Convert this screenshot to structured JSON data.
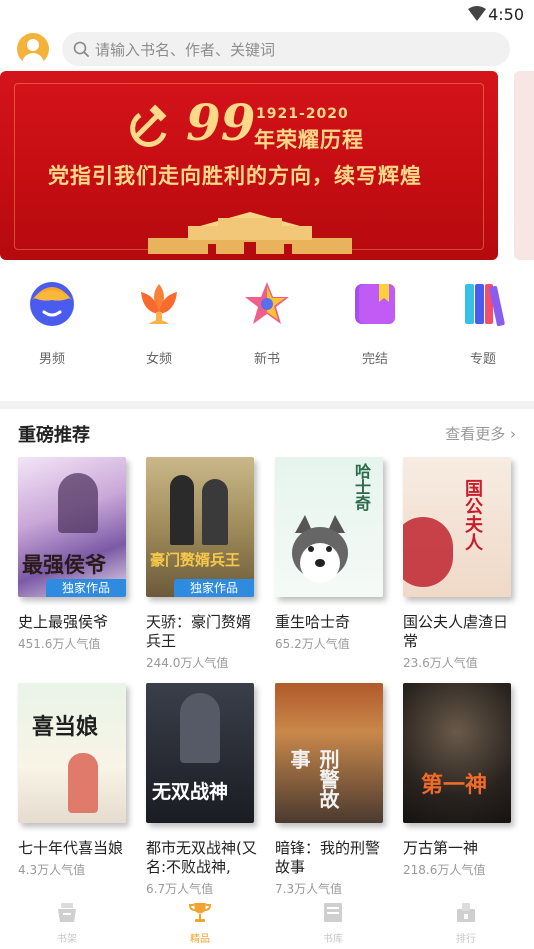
{
  "status": {
    "time": "4:50"
  },
  "search": {
    "placeholder": "请输入书名、作者、关键词"
  },
  "banner": {
    "number": "99",
    "years": "1921-2020",
    "honor": "年荣耀历程",
    "slogan": "党指引我们走向胜利的方向，续写辉煌"
  },
  "categories": [
    {
      "label": "男频",
      "icon": "male-channel-icon"
    },
    {
      "label": "女频",
      "icon": "female-channel-icon"
    },
    {
      "label": "新书",
      "icon": "new-book-star-icon"
    },
    {
      "label": "完结",
      "icon": "completed-book-icon"
    },
    {
      "label": "专题",
      "icon": "topic-books-icon"
    }
  ],
  "section": {
    "title": "重磅推荐",
    "more": "查看更多 ›"
  },
  "books": [
    {
      "title": "史上最强侯爷",
      "popularity": "451.6万人气值",
      "badge": "独家作品",
      "cover_text": "最强侯爷"
    },
    {
      "title": "天骄：豪门赘婿兵王",
      "popularity": "244.0万人气值",
      "badge": "独家作品",
      "cover_text": "豪门赘婿兵王"
    },
    {
      "title": "重生哈士奇",
      "popularity": "65.2万人气值",
      "badge": "",
      "cover_text": "哈士奇"
    },
    {
      "title": "国公夫人虐渣日常",
      "popularity": "23.6万人气值",
      "badge": "",
      "cover_text": "国公夫人"
    },
    {
      "title": "七十年代喜当娘",
      "popularity": "4.3万人气值",
      "badge": "",
      "cover_text": "喜当娘"
    },
    {
      "title": "都市无双战神(又名:不败战神,主...",
      "popularity": "6.7万人气值",
      "badge": "",
      "cover_text": "无双战神"
    },
    {
      "title": "暗锋：我的刑警故事",
      "popularity": "7.3万人气值",
      "badge": "",
      "cover_text": "刑警故事"
    },
    {
      "title": "万古第一神",
      "popularity": "218.6万人气值",
      "badge": "",
      "cover_text": "第一神"
    }
  ],
  "tabs": [
    {
      "label": "书架",
      "icon": "bookshelf-icon",
      "active": false
    },
    {
      "label": "精品",
      "icon": "trophy-icon",
      "active": true
    },
    {
      "label": "书库",
      "icon": "library-icon",
      "active": false
    },
    {
      "label": "排行",
      "icon": "ranking-icon",
      "active": false
    }
  ],
  "colors": {
    "accent": "#f0a431",
    "badge": "#2f8be0",
    "banner": "#c40d12"
  }
}
